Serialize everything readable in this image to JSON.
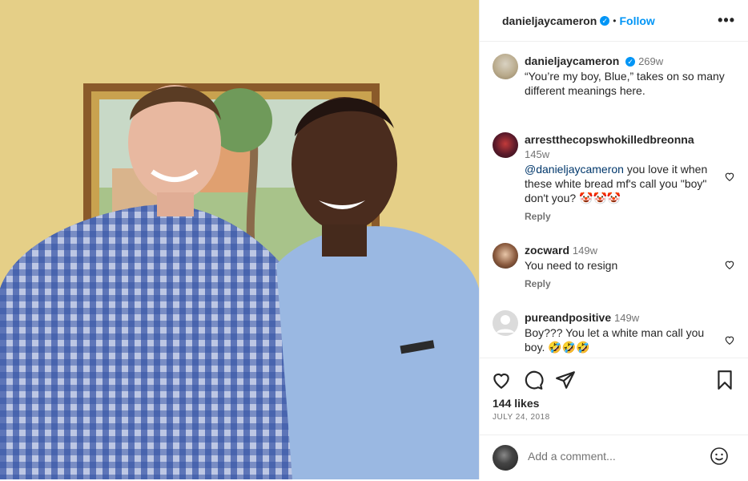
{
  "header": {
    "username": "danieljaycameron",
    "separator": "•",
    "follow_label": "Follow",
    "more_label": "•••"
  },
  "caption": {
    "username": "danieljaycameron",
    "time": "269w",
    "text": "“You’re my boy, Blue,” takes on so many different meanings here."
  },
  "comments": [
    {
      "username": "arrestthecopswhokilledbreonna",
      "time": "145w",
      "mention": "@danieljaycameron",
      "text": " you love it when these white bread mf's call you \"boy\" don't you? 🤡🤡🤡",
      "reply": "Reply"
    },
    {
      "username": "zocward",
      "time": "149w",
      "text": "You need to resign",
      "reply": "Reply"
    },
    {
      "username": "pureandpositive",
      "time": "149w",
      "text": "Boy??? You let a white man call you boy. 🤣🤣🤣"
    }
  ],
  "actions": {
    "likes": "144 likes",
    "date": "JULY 24, 2018"
  },
  "add_comment": {
    "placeholder": "Add a comment..."
  },
  "colors": {
    "accent": "#0095f6",
    "mention": "#00376b",
    "muted": "#737373"
  }
}
